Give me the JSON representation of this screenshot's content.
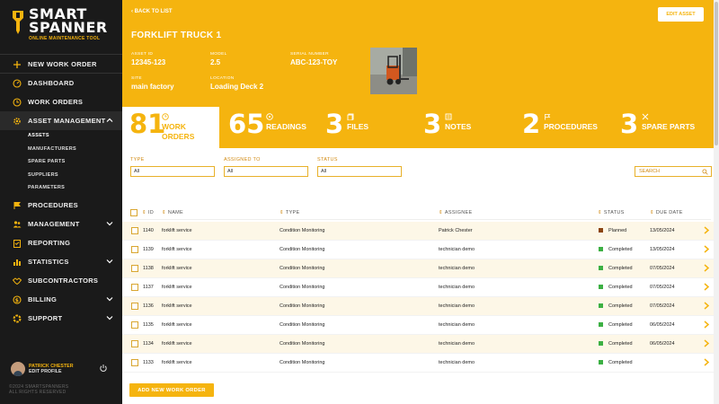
{
  "brand": {
    "name_line1": "SMART",
    "name_line2": "SPANNER",
    "tagline": "ONLINE MAINTENANCE TOOL"
  },
  "sidebar": {
    "new_work_order": "NEW WORK ORDER",
    "items": [
      {
        "label": "DASHBOARD",
        "icon": "dashboard-icon"
      },
      {
        "label": "WORK ORDERS",
        "icon": "clock-icon"
      },
      {
        "label": "ASSET MANAGEMENT",
        "icon": "gear-icon"
      },
      {
        "label": "PROCEDURES",
        "icon": "flag-icon"
      },
      {
        "label": "MANAGEMENT",
        "icon": "people-icon"
      },
      {
        "label": "REPORTING",
        "icon": "clipboard-icon"
      },
      {
        "label": "STATISTICS",
        "icon": "bar-chart-icon"
      },
      {
        "label": "SUBCONTRACTORS",
        "icon": "handshake-icon"
      },
      {
        "label": "BILLING",
        "icon": "money-icon"
      },
      {
        "label": "SUPPORT",
        "icon": "lifebuoy-icon"
      }
    ],
    "sub_items": [
      "ASSETS",
      "MANUFACTURERS",
      "SPARE PARTS",
      "SUPPLIERS",
      "PARAMETERS"
    ],
    "user_name": "PATRICK CHESTER",
    "edit_profile": "EDIT PROFILE",
    "copyright1": "©2024 SMARTSPANNERS",
    "copyright2": "ALL RIGHTS RESERVED"
  },
  "header": {
    "back": "BACK TO LIST",
    "edit": "EDIT ASSET",
    "title": "FORKLIFT TRUCK 1",
    "fields": {
      "asset_id_label": "ASSET ID",
      "asset_id": "12345-123",
      "model_label": "MODEL",
      "model": "2.5",
      "serial_label": "SERIAL NUMBER",
      "serial": "ABC-123-TOY",
      "site_label": "SITE",
      "site": "main factory",
      "location_label": "LOCATION",
      "location": "Loading Deck 2"
    }
  },
  "stats": [
    {
      "num": "81",
      "label1": "WORK",
      "label2": "ORDERS",
      "icon": "clock-icon"
    },
    {
      "num": "65",
      "label1": "READINGS",
      "label2": "",
      "icon": "gauge-icon"
    },
    {
      "num": "3",
      "label1": "FILES",
      "label2": "",
      "icon": "files-icon"
    },
    {
      "num": "3",
      "label1": "NOTES",
      "label2": "",
      "icon": "note-icon"
    },
    {
      "num": "2",
      "label1": "PROCEDURES",
      "label2": "",
      "icon": "flag-icon"
    },
    {
      "num": "3",
      "label1": "SPARE PARTS",
      "label2": "",
      "icon": "tools-icon"
    }
  ],
  "filters": {
    "type_label": "TYPE",
    "type_value": "All",
    "assigned_label": "ASSIGNED TO",
    "assigned_value": "All",
    "status_label": "STATUS",
    "status_value": "All",
    "search_placeholder": "SEARCH"
  },
  "table": {
    "headers": {
      "id": "ID",
      "name": "NAME",
      "type": "TYPE",
      "assignee": "ASSIGNEE",
      "status": "STATUS",
      "due": "DUE DATE"
    },
    "rows": [
      {
        "id": "1140",
        "name": "forklift service",
        "type": "Condition Monitoring",
        "assignee": "Patrick Chester",
        "status": "Planned",
        "status_color": "#8b4513",
        "due": "13/05/2024"
      },
      {
        "id": "1139",
        "name": "forklift service",
        "type": "Condition Monitoring",
        "assignee": "technician demo",
        "status": "Completed",
        "status_color": "#3cb043",
        "due": "13/05/2024"
      },
      {
        "id": "1138",
        "name": "forklift service",
        "type": "Condition Monitoring",
        "assignee": "technician demo",
        "status": "Completed",
        "status_color": "#3cb043",
        "due": "07/05/2024"
      },
      {
        "id": "1137",
        "name": "forklift service",
        "type": "Condition Monitoring",
        "assignee": "technician demo",
        "status": "Completed",
        "status_color": "#3cb043",
        "due": "07/05/2024"
      },
      {
        "id": "1136",
        "name": "forklift service",
        "type": "Condition Monitoring",
        "assignee": "technician demo",
        "status": "Completed",
        "status_color": "#3cb043",
        "due": "07/05/2024"
      },
      {
        "id": "1135",
        "name": "forklift service",
        "type": "Condition Monitoring",
        "assignee": "technician demo",
        "status": "Completed",
        "status_color": "#3cb043",
        "due": "06/05/2024"
      },
      {
        "id": "1134",
        "name": "forklift service",
        "type": "Condition Monitoring",
        "assignee": "technician demo",
        "status": "Completed",
        "status_color": "#3cb043",
        "due": "06/05/2024"
      },
      {
        "id": "1133",
        "name": "forklift service",
        "type": "Condition Monitoring",
        "assignee": "technician demo",
        "status": "Completed",
        "status_color": "#3cb043",
        "due": ""
      }
    ]
  },
  "add_button": "ADD NEW WORK ORDER",
  "colors": {
    "accent": "#f5b40f",
    "sidebar": "#1a1a1a"
  }
}
